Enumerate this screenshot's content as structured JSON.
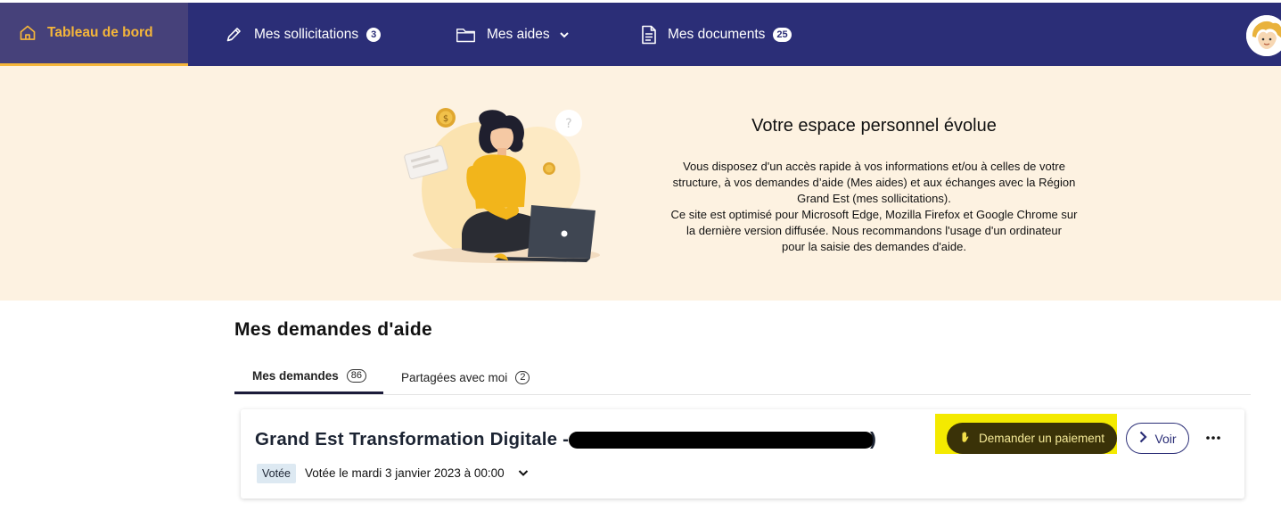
{
  "nav": {
    "items": [
      {
        "label": "Tableau de bord",
        "icon": "home-icon",
        "active": true
      },
      {
        "label": "Mes sollicitations",
        "icon": "pen-icon",
        "badge": "3"
      },
      {
        "label": "Mes aides",
        "icon": "folder-icon"
      },
      {
        "label": "Mes documents",
        "icon": "document-icon",
        "badge": "25"
      }
    ],
    "colors": {
      "background": "#2b2e77",
      "active_background": "#46417a",
      "accent": "#f5b63a"
    }
  },
  "banner": {
    "title": "Votre espace personnel évolue",
    "lines": [
      "Vous disposez d'un accès rapide à vos informations et/ou à celles de votre",
      "structure, à vos demandes d’aide (Mes aides) et aux échanges avec la Région",
      "Grand Est (mes sollicitations).",
      "Ce site est optimisé pour Microsoft Edge, Mozilla Firefox et Google Chrome sur",
      "la dernière version diffusée. Nous recommandons l'usage d'un ordinateur",
      "pour la saisie des demandes d'aide."
    ],
    "background": "#fdf2e1"
  },
  "section": {
    "title": "Mes demandes d'aide",
    "tabs": [
      {
        "label": "Mes demandes",
        "count": "86",
        "active": true
      },
      {
        "label": "Partagées avec moi",
        "count": "2"
      }
    ]
  },
  "card": {
    "title": "Grand Est Transformation Digitale -",
    "title_suffix": ")",
    "status_badge": "Votée",
    "status_text": "Votée le mardi 3 janvier 2023 à 00:00",
    "pay_button": "Demander un paiement",
    "view_button": "Voir"
  }
}
